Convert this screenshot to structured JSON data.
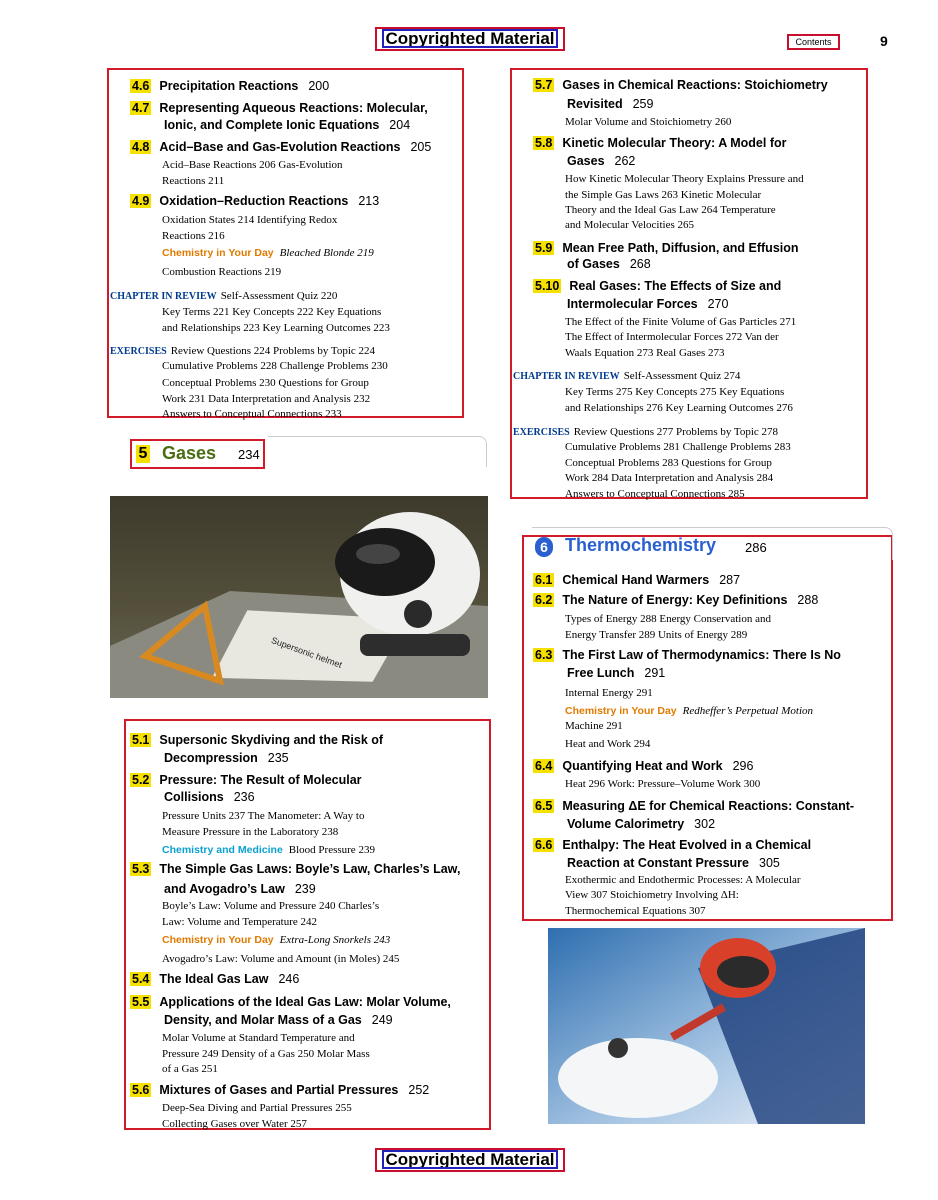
{
  "header": {
    "banner": "Copyrighted Material",
    "contents_label": "Contents",
    "page_number": "9"
  },
  "footer": {
    "banner": "Copyrighted Material"
  },
  "left_top": [
    {
      "kind": "h",
      "num": "4.6",
      "text": "Precipitation Reactions",
      "page": "200"
    },
    {
      "kind": "h",
      "num": "4.7",
      "text": "Representing Aqueous Reactions: Molecular,"
    },
    {
      "kind": "h2",
      "text": "Ionic, and Complete Ionic Equations",
      "page": "204"
    },
    {
      "kind": "h",
      "num": "4.8",
      "text": "Acid–Base and Gas-Evolution Reactions",
      "page": "205"
    },
    {
      "kind": "s",
      "text": "Acid–Base Reactions  206   Gas-Evolution"
    },
    {
      "kind": "s",
      "text": "Reactions  211"
    },
    {
      "kind": "h",
      "num": "4.9",
      "text": "Oxidation–Reduction Reactions",
      "page": "213"
    },
    {
      "kind": "s",
      "text": "Oxidation States  214   Identifying Redox"
    },
    {
      "kind": "s",
      "text": "Reactions  216"
    },
    {
      "kind": "sc",
      "orange": "Chemistry in Your Day",
      "text": "Bleached Blonde  219"
    },
    {
      "kind": "s",
      "text": "Combustion Reactions  219"
    },
    {
      "kind": "review",
      "label": "CHAPTER IN REVIEW",
      "text": "Self-Assessment Quiz  220"
    },
    {
      "kind": "s",
      "text": "Key Terms  221   Key Concepts  222   Key Equations"
    },
    {
      "kind": "s",
      "text": "and Relationships  223   Key Learning Outcomes  223"
    },
    {
      "kind": "review",
      "label": "EXERCISES",
      "text": "Review Questions  224   Problems by Topic  224"
    },
    {
      "kind": "s",
      "text": "Cumulative Problems  228   Challenge Problems  230"
    },
    {
      "kind": "s",
      "text": "Conceptual Problems  230   Questions for Group"
    },
    {
      "kind": "s",
      "text": "Work  231   Data Interpretation and Analysis  232"
    },
    {
      "kind": "s",
      "text": "Answers to Conceptual Connections  233"
    }
  ],
  "chapter5": {
    "num": "5",
    "title": "Gases",
    "page": "234"
  },
  "left_bottom": [
    {
      "kind": "h",
      "num": "5.1",
      "text": "Supersonic Skydiving and the Risk of"
    },
    {
      "kind": "h2",
      "text": "Decompression",
      "page": "235"
    },
    {
      "kind": "h",
      "num": "5.2",
      "text": "Pressure: The Result of Molecular"
    },
    {
      "kind": "h2",
      "text": "Collisions",
      "page": "236"
    },
    {
      "kind": "s",
      "text": "Pressure Units  237   The Manometer: A Way to"
    },
    {
      "kind": "s",
      "text": "Measure Pressure in the Laboratory  238"
    },
    {
      "kind": "sc",
      "cyan": "Chemistry and Medicine",
      "text": "Blood Pressure  239"
    },
    {
      "kind": "h",
      "num": "5.3",
      "text": "The Simple Gas Laws: Boyle’s Law, Charles’s Law,"
    },
    {
      "kind": "h2",
      "text": "and Avogadro’s Law",
      "page": "239"
    },
    {
      "kind": "s",
      "text": "Boyle’s Law: Volume and Pressure  240   Charles’s"
    },
    {
      "kind": "s",
      "text": "Law: Volume and Temperature  242"
    },
    {
      "kind": "sc",
      "orange": "Chemistry in Your Day",
      "text": "Extra-Long Snorkels  243"
    },
    {
      "kind": "s",
      "text": "Avogadro’s Law: Volume and Amount (in Moles)  245"
    },
    {
      "kind": "h",
      "num": "5.4",
      "text": "The Ideal Gas Law",
      "page": "246"
    },
    {
      "kind": "h",
      "num": "5.5",
      "text": "Applications of the Ideal Gas Law: Molar Volume,"
    },
    {
      "kind": "h2",
      "text": "Density, and Molar Mass of a Gas",
      "page": "249"
    },
    {
      "kind": "s",
      "text": "Molar Volume at Standard Temperature and"
    },
    {
      "kind": "s",
      "text": "Pressure  249   Density of a Gas  250   Molar Mass"
    },
    {
      "kind": "s",
      "text": "of a Gas  251"
    },
    {
      "kind": "h",
      "num": "5.6",
      "text": "Mixtures of Gases and Partial Pressures",
      "page": "252"
    },
    {
      "kind": "s",
      "text": "Deep-Sea Diving and Partial Pressures  255"
    },
    {
      "kind": "s",
      "text": "Collecting Gases over Water  257"
    }
  ],
  "right_top": [
    {
      "kind": "h",
      "num": "5.7",
      "text": "Gases in Chemical Reactions: Stoichiometry"
    },
    {
      "kind": "h2",
      "text": "Revisited",
      "page": "259"
    },
    {
      "kind": "s",
      "text": "Molar Volume and Stoichiometry  260"
    },
    {
      "kind": "h",
      "num": "5.8",
      "text": "Kinetic Molecular Theory: A Model for"
    },
    {
      "kind": "h2",
      "text": "Gases",
      "page": "262"
    },
    {
      "kind": "s",
      "text": "How Kinetic Molecular Theory Explains Pressure and"
    },
    {
      "kind": "s",
      "text": "the Simple Gas Laws  263   Kinetic Molecular"
    },
    {
      "kind": "s",
      "text": "Theory and the Ideal Gas Law  264   Temperature"
    },
    {
      "kind": "s",
      "text": "and Molecular Velocities  265"
    },
    {
      "kind": "h",
      "num": "5.9",
      "text": "Mean Free Path, Diffusion, and Effusion"
    },
    {
      "kind": "h2",
      "text": "of Gases",
      "page": "268"
    },
    {
      "kind": "h",
      "num": "5.10",
      "text": "Real Gases: The Effects of Size and"
    },
    {
      "kind": "h2",
      "text": "Intermolecular Forces",
      "page": "270"
    },
    {
      "kind": "s",
      "text": "The Effect of the Finite Volume of Gas Particles  271"
    },
    {
      "kind": "s",
      "text": "The Effect of Intermolecular Forces  272   Van der"
    },
    {
      "kind": "s",
      "text": "Waals Equation  273   Real Gases  273"
    },
    {
      "kind": "review",
      "label": "CHAPTER IN REVIEW",
      "text": "Self-Assessment Quiz  274"
    },
    {
      "kind": "s",
      "text": "Key Terms  275   Key Concepts  275   Key Equations"
    },
    {
      "kind": "s",
      "text": "and Relationships  276   Key Learning Outcomes  276"
    },
    {
      "kind": "review",
      "label": "EXERCISES",
      "text": "Review Questions  277   Problems by Topic  278"
    },
    {
      "kind": "s",
      "text": "Cumulative Problems  281   Challenge Problems  283"
    },
    {
      "kind": "s",
      "text": "Conceptual Problems  283   Questions for Group"
    },
    {
      "kind": "s",
      "text": "Work  284   Data Interpretation and Analysis  284"
    },
    {
      "kind": "s",
      "text": "Answers to Conceptual Connections  285"
    }
  ],
  "chapter6": {
    "num": "6",
    "title": "Thermochemistry",
    "page": "286"
  },
  "right_bottom": [
    {
      "kind": "h",
      "num": "6.1",
      "text": "Chemical Hand Warmers",
      "page": "287"
    },
    {
      "kind": "h",
      "num": "6.2",
      "text": "The Nature of Energy: Key Definitions",
      "page": "288"
    },
    {
      "kind": "s",
      "text": "Types of Energy  288   Energy Conservation and"
    },
    {
      "kind": "s",
      "text": "Energy Transfer  289   Units of Energy  289"
    },
    {
      "kind": "h",
      "num": "6.3",
      "text": "The First Law of Thermodynamics: There Is No"
    },
    {
      "kind": "h2",
      "text": "Free Lunch",
      "page": "291"
    },
    {
      "kind": "s",
      "text": "Internal Energy  291"
    },
    {
      "kind": "sc",
      "orange": "Chemistry in Your Day",
      "text": "Redheffer’s Perpetual Motion"
    },
    {
      "kind": "s",
      "text": "Machine  291"
    },
    {
      "kind": "s",
      "text": "Heat and Work  294"
    },
    {
      "kind": "h",
      "num": "6.4",
      "text": "Quantifying Heat and Work",
      "page": "296"
    },
    {
      "kind": "s",
      "text": "Heat  296   Work: Pressure–Volume Work  300"
    },
    {
      "kind": "h",
      "num": "6.5",
      "text": "Measuring ΔE for Chemical Reactions: Constant-"
    },
    {
      "kind": "h2",
      "text": "Volume Calorimetry",
      "page": "302"
    },
    {
      "kind": "h",
      "num": "6.6",
      "text": "Enthalpy: The Heat Evolved in a Chemical"
    },
    {
      "kind": "h2",
      "text": "Reaction at Constant Pressure",
      "page": "305"
    },
    {
      "kind": "s",
      "text": "Exothermic and Endothermic Processes: A Molecular"
    },
    {
      "kind": "s",
      "text": "View  307   Stoichiometry Involving ΔH:"
    },
    {
      "kind": "s",
      "text": "Thermochemical Equations  307"
    }
  ],
  "photo1": {
    "caption": "Supersonic helmet"
  },
  "colors": {
    "border_red": "#d11a2a",
    "box_blue": "#1d1dcc",
    "highlight_yellow": "#f5e000",
    "orange": "#e07a00",
    "cyan": "#0aa0d0"
  }
}
